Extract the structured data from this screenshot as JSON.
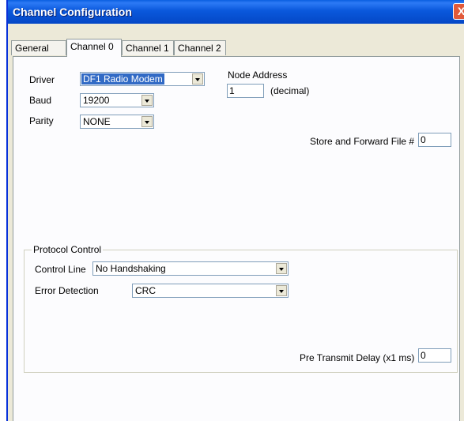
{
  "window": {
    "title": "Channel Configuration",
    "close_label": "X"
  },
  "tabs": [
    {
      "label": "General",
      "active": false
    },
    {
      "label": "Channel 0",
      "active": true
    },
    {
      "label": "Channel 1",
      "active": false
    },
    {
      "label": "Channel 2",
      "active": false
    }
  ],
  "channel": {
    "driver_label": "Driver",
    "driver_value": "DF1 Radio Modem",
    "baud_label": "Baud",
    "baud_value": "19200",
    "parity_label": "Parity",
    "parity_value": "NONE",
    "node_address_label": "Node Address",
    "node_address_value": "1",
    "node_address_unit": "(decimal)",
    "store_forward_label": "Store and Forward File #",
    "store_forward_value": "0"
  },
  "protocol": {
    "group_label": "Protocol Control",
    "control_line_label": "Control Line",
    "control_line_value": "No Handshaking",
    "error_detection_label": "Error Detection",
    "error_detection_value": "CRC",
    "pre_transmit_label": "Pre Transmit Delay (x1 ms)",
    "pre_transmit_value": "0"
  }
}
